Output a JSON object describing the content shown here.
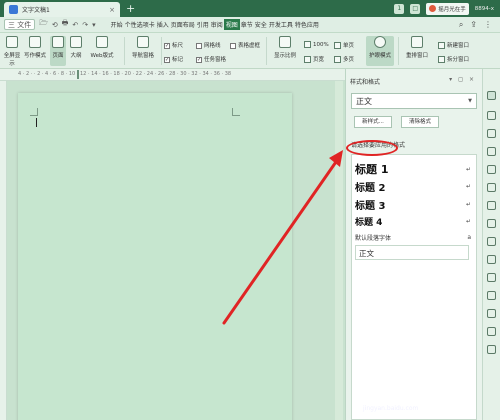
{
  "titlebar": {
    "tab_title": "文字文稿1",
    "close": "×",
    "add": "+",
    "badge1": "1",
    "user_name": "摇月光在手",
    "user_id": "8894-x",
    "sq_box": "□"
  },
  "quick_access": {
    "file_label": "三 文件",
    "icons": [
      "🗁",
      "⟲",
      "🖶",
      "↶",
      "↷",
      "▾"
    ]
  },
  "menus": [
    "开始",
    "个性选项卡",
    "插入",
    "页面布局",
    "引用",
    "审阅",
    "视图",
    "章节",
    "安全",
    "开发工具",
    "特色应用"
  ],
  "active_menu": "视图",
  "ribbon": {
    "views": [
      "全屏显示",
      "写作模式",
      "页面",
      "大纲",
      "Web版式"
    ],
    "nav_pane": "导航窗格",
    "checks": [
      {
        "label": "标尺",
        "checked": true
      },
      {
        "label": "网格线",
        "checked": false
      },
      {
        "label": "表格虚框",
        "checked": false
      },
      {
        "label": "标记",
        "checked": true
      },
      {
        "label": "任务窗格",
        "checked": true
      }
    ],
    "show_ratio": "显示比例",
    "zoom": "100%",
    "page_width": "页宽",
    "single_page": "单页",
    "multi_page": "多页",
    "eye_mode": "护眼模式",
    "rearrange": "重排窗口",
    "new_window": "新建窗口",
    "split_window": "拆分窗口"
  },
  "ruler_nums": "4  ·  2  ·  ·  2  ·  4  ·  6  ·  8  ·  10  ·  12  ·  14  ·  16  ·  18  ·  20  ·  22  ·  24  ·  26  ·  28  ·  30  ·  32  ·  34  ·  36  ·  38",
  "panel": {
    "title": "样式和格式",
    "controls": "▾ ◻ ×",
    "current_style": "正文",
    "new_style_btn": "新样式...",
    "clear_format_btn": "清除格式",
    "hint": "请选择要应用的格式",
    "styles": [
      {
        "name": "标题 1",
        "mark": "↵"
      },
      {
        "name": "标题 2",
        "mark": "↵"
      },
      {
        "name": "标题 3",
        "mark": "↵"
      },
      {
        "name": "标题 4",
        "mark": "↵"
      },
      {
        "name": "默认段落字体",
        "mark": "a"
      }
    ],
    "bottom_style": "正文"
  },
  "watermark": "Bai 经验",
  "watermark_sub": "jingyan.baidu.com",
  "colors": {
    "titlebar": "#2d6b49",
    "eye_green_bg": "#c8e2cf",
    "active_menu": "#2b7a4b",
    "annotation_red": "#e02424"
  }
}
